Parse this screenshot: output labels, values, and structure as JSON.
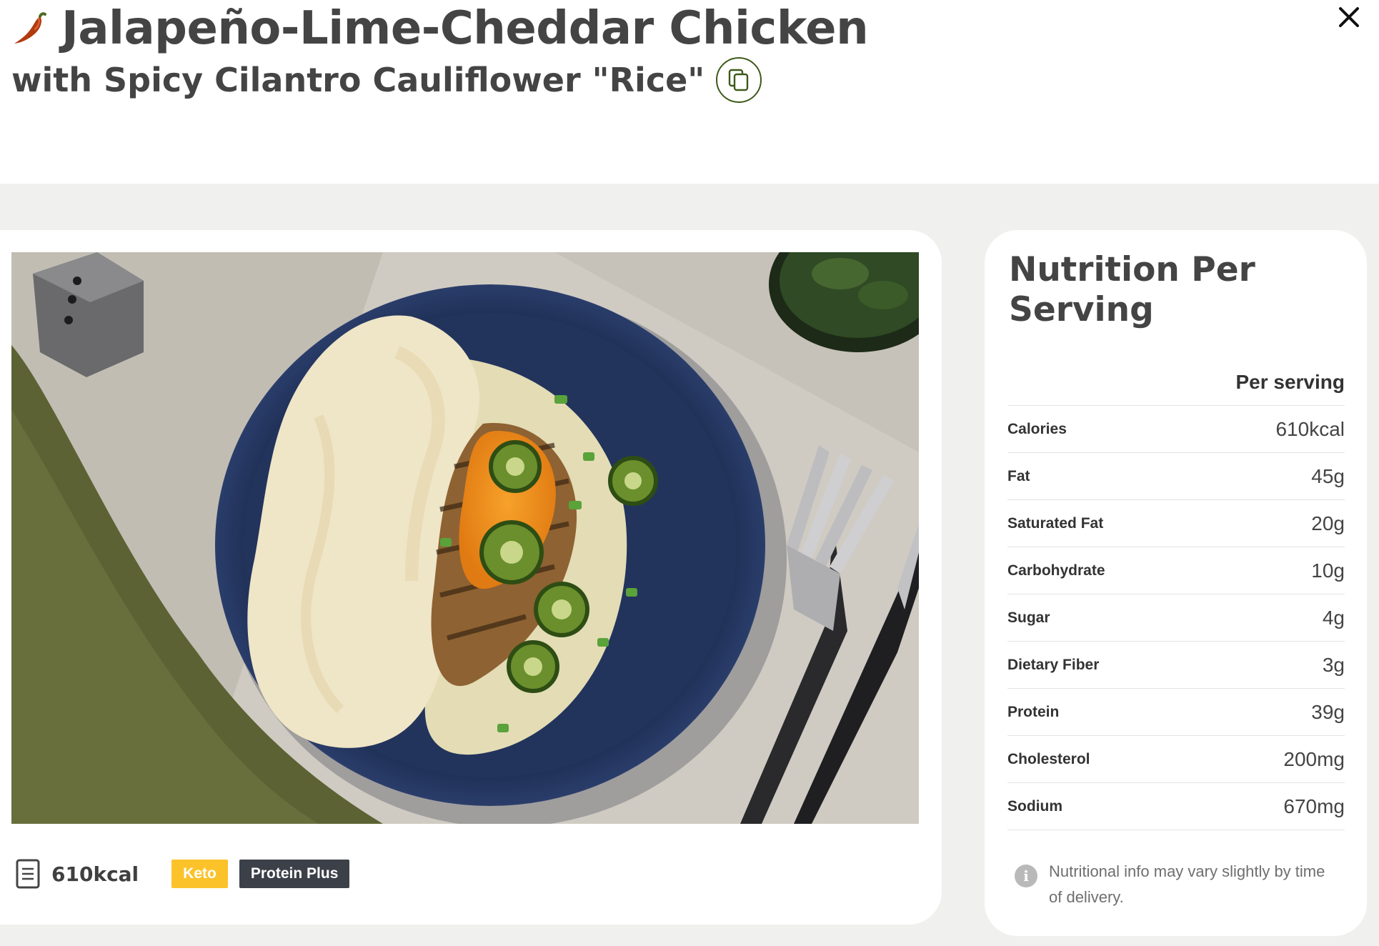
{
  "header": {
    "title": "Jalapeño-Lime-Cheddar Chicken",
    "subtitle": "with Spicy Cilantro Cauliflower \"Rice\"",
    "icons": {
      "title_icon": "chili-pepper-icon",
      "copy": "copy-icon",
      "close": "close-icon"
    }
  },
  "recipe": {
    "photo_alt": "Jalapeño-Lime-Cheddar Chicken with Spicy Cilantro Cauliflower Rice",
    "calories": "610kcal",
    "tags": [
      {
        "label": "Keto",
        "color": "#fbc22a"
      },
      {
        "label": "Protein Plus",
        "color": "#3c4048"
      }
    ]
  },
  "nutrition": {
    "title": "Nutrition Per Serving",
    "column_header": "Per serving",
    "rows": [
      {
        "name": "Calories",
        "value": "610kcal"
      },
      {
        "name": "Fat",
        "value": "45g"
      },
      {
        "name": "Saturated Fat",
        "value": "20g"
      },
      {
        "name": "Carbohydrate",
        "value": "10g"
      },
      {
        "name": "Sugar",
        "value": "4g"
      },
      {
        "name": "Dietary Fiber",
        "value": "3g"
      },
      {
        "name": "Protein",
        "value": "39g"
      },
      {
        "name": "Cholesterol",
        "value": "200mg"
      },
      {
        "name": "Sodium",
        "value": "670mg"
      }
    ],
    "note": "Nutritional info may vary slightly by time of delivery."
  },
  "colors": {
    "page_background": "#f0f1ef",
    "heading": "#444444",
    "accent_green": "#3d5a1a",
    "keto_tag": "#fbc22a",
    "protein_tag": "#3c4048"
  }
}
